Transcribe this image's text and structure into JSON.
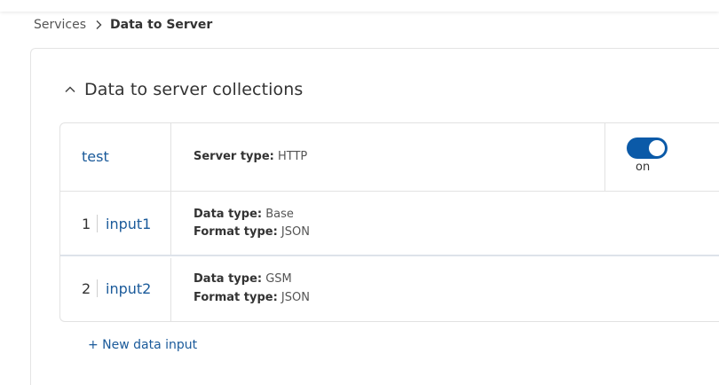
{
  "breadcrumb": {
    "parent": "Services",
    "separator_icon": "chevron-right-icon",
    "current": "Data to Server"
  },
  "section": {
    "title": "Data to server collections",
    "collapse_icon": "chevron-up-icon"
  },
  "collection": {
    "name": "test",
    "server_type_label": "Server type:",
    "server_type_value": "HTTP",
    "toggle_state": "on",
    "accent_color": "#0b5aa8"
  },
  "inputs": [
    {
      "index": "1",
      "name": "input1",
      "data_type_label": "Data type:",
      "data_type_value": "Base",
      "format_type_label": "Format type:",
      "format_type_value": "JSON"
    },
    {
      "index": "2",
      "name": "input2",
      "data_type_label": "Data type:",
      "data_type_value": "GSM",
      "format_type_label": "Format type:",
      "format_type_value": "JSON"
    }
  ],
  "actions": {
    "new_input_label": "+ New data input"
  }
}
